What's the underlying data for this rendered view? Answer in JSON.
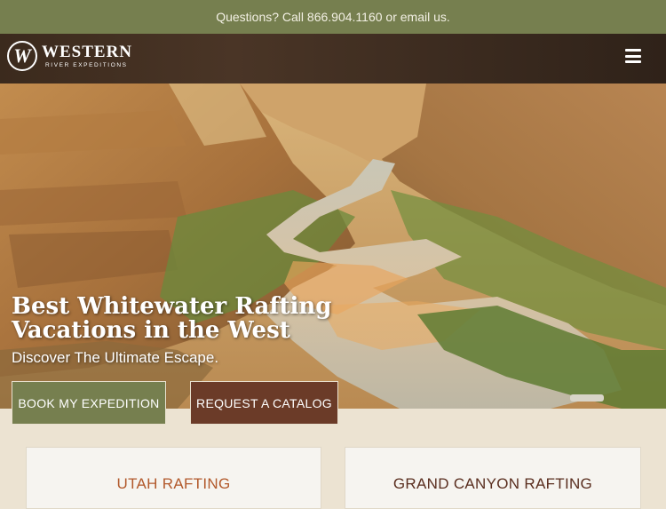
{
  "topbar": {
    "text": "Questions? Call 866.904.1160 or email us."
  },
  "header": {
    "logo_title": "WESTERN",
    "logo_subtitle": "RIVER EXPEDITIONS",
    "logo_mark": "W",
    "menu_icon": "hamburger-menu-icon"
  },
  "hero": {
    "title": "Best Whitewater Rafting Vacations in the West",
    "subtitle": "Discover The Ultimate Escape."
  },
  "buttons": {
    "book": "BOOK MY EXPEDITION",
    "catalog": "REQUEST A CATALOG"
  },
  "cards": [
    {
      "title": "UTAH RAFTING"
    },
    {
      "title": "GRAND CANYON RAFTING"
    }
  ],
  "colors": {
    "olive": "#767f4f",
    "brown": "#6b3b28",
    "background": "#ece3d2",
    "utah_title": "#b2592b"
  }
}
